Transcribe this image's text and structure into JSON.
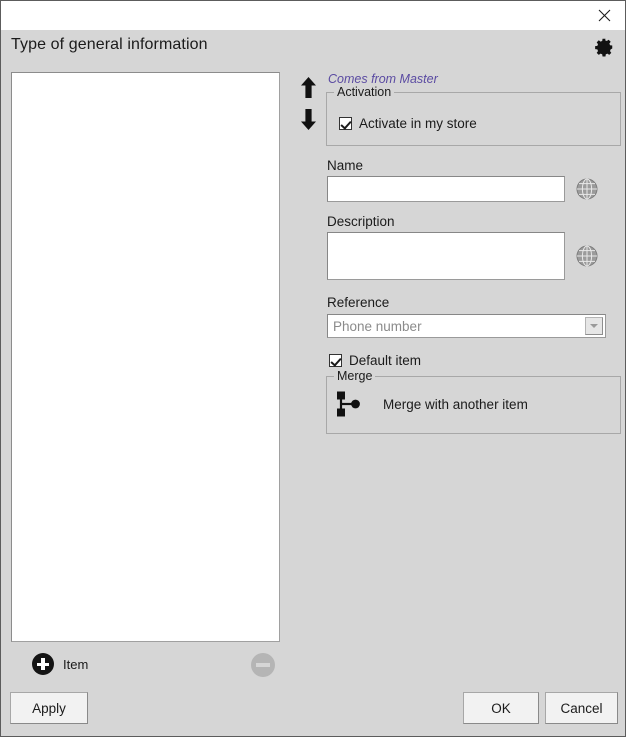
{
  "window": {
    "title_bar": {
      "close_label": "✕",
      "close_icon": "close-icon"
    },
    "header": {
      "title": "Type of general information",
      "settings_icon": "gear-icon"
    }
  },
  "list_panel": {
    "items": [],
    "add_item_label": "Item",
    "add_icon": "plus-circle-icon",
    "remove_icon": "minus-circle-icon"
  },
  "reorder": {
    "up_icon": "arrow-up-icon",
    "down_icon": "arrow-down-icon"
  },
  "detail_panel": {
    "master_note": "Comes from Master",
    "activation": {
      "legend": "Activation",
      "checkbox_label": "Activate in my store",
      "checked": true
    },
    "name": {
      "label": "Name",
      "value": "",
      "placeholder": "",
      "translate_icon": "globe-icon"
    },
    "description": {
      "label": "Description",
      "value": "",
      "placeholder": "",
      "translate_icon": "globe-icon"
    },
    "reference": {
      "label": "Reference",
      "value": "Phone number",
      "options": [
        "Phone number"
      ],
      "dropdown_icon": "chevron-down-icon"
    },
    "default_item": {
      "label": "Default item",
      "checked": true
    },
    "merge": {
      "legend": "Merge",
      "action_label": "Merge with another item",
      "icon": "merge-node-icon"
    }
  },
  "footer": {
    "apply_label": "Apply",
    "ok_label": "OK",
    "cancel_label": "Cancel"
  },
  "colors": {
    "dialog_background": "#d6d6d6",
    "titlebar_background": "#ffffff",
    "master_note_color": "#5b4ba2",
    "field_background": "#ffffff",
    "border": "#a0a0a0"
  }
}
